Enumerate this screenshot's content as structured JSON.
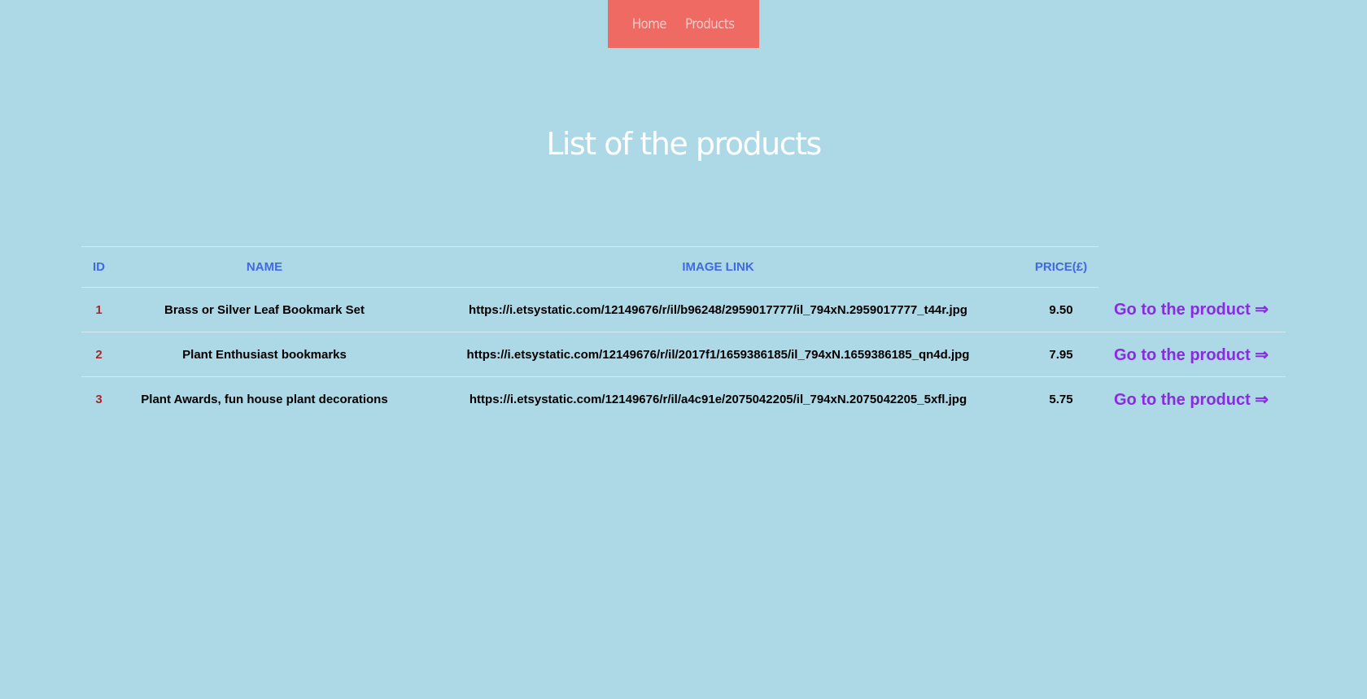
{
  "nav": {
    "home": "Home",
    "products": "Products"
  },
  "page": {
    "title": "List of the products"
  },
  "table": {
    "headers": [
      "ID",
      "NAME",
      "IMAGE LINK",
      "PRICE(£)"
    ],
    "rows": [
      {
        "id": "1",
        "name": "Brass or Silver Leaf Bookmark Set",
        "image_link": "https://i.etsystatic.com/12149676/r/il/b96248/2959017777/il_794xN.2959017777_t44r.jpg",
        "price": "9.50",
        "action": "Go to the product ⇒"
      },
      {
        "id": "2",
        "name": "Plant Enthusiast bookmarks",
        "image_link": "https://i.etsystatic.com/12149676/r/il/2017f1/1659386185/il_794xN.1659386185_qn4d.jpg",
        "price": "7.95",
        "action": "Go to the product ⇒"
      },
      {
        "id": "3",
        "name": "Plant Awards, fun house plant decorations",
        "image_link": "https://i.etsystatic.com/12149676/r/il/a4c91e/2075042205/il_794xN.2075042205_5xfl.jpg",
        "price": "5.75",
        "action": "Go to the product ⇒"
      }
    ]
  },
  "colors": {
    "background": "#add8e6",
    "nav_background": "#f06a64",
    "header_text": "#4169e1",
    "id_text": "#a52a2a",
    "link_text": "#8a2be2",
    "title_text": "#ffffff"
  }
}
